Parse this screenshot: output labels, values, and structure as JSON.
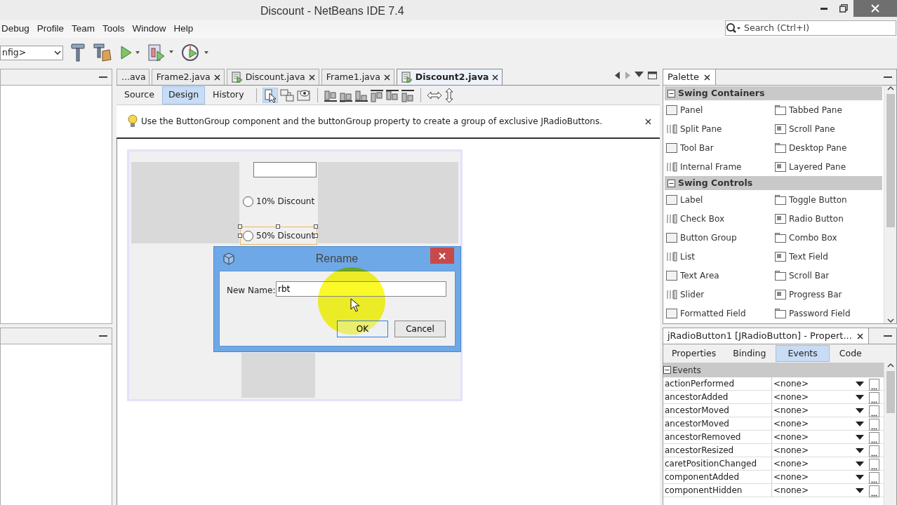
{
  "window": {
    "title": "Discount - NetBeans IDE 7.4"
  },
  "menu": [
    "Debug",
    "Profile",
    "Team",
    "Tools",
    "Window",
    "Help"
  ],
  "search": {
    "placeholder": "Search (Ctrl+I)"
  },
  "config_combo": {
    "value": "nfig>"
  },
  "editor_tabs": [
    {
      "label": "...ava",
      "selected": false,
      "closable": false,
      "kind": "plain"
    },
    {
      "label": "Frame2.java",
      "selected": false,
      "closable": true,
      "kind": "plain"
    },
    {
      "label": "Discount.java",
      "selected": false,
      "closable": true,
      "kind": "form"
    },
    {
      "label": "Frame1.java",
      "selected": false,
      "closable": true,
      "kind": "plain"
    },
    {
      "label": "Discount2.java",
      "selected": true,
      "closable": true,
      "kind": "form"
    }
  ],
  "view_tabs": [
    {
      "label": "Source",
      "selected": false
    },
    {
      "label": "Design",
      "selected": true
    },
    {
      "label": "History",
      "selected": false
    }
  ],
  "hint": {
    "text": "Use the ButtonGroup component and the buttonGroup property to create a group of exclusive JRadioButtons."
  },
  "form": {
    "radios": [
      {
        "label": "10% Discount",
        "checked": false,
        "selected": false
      },
      {
        "label": "50% Discount",
        "checked": false,
        "selected": true
      }
    ]
  },
  "dialog": {
    "title": "Rename",
    "label": "New Name:",
    "value": "rbt",
    "buttons": [
      {
        "label": "OK",
        "default": true
      },
      {
        "label": "Cancel",
        "default": false
      }
    ]
  },
  "palette": {
    "title": "Palette",
    "categories": [
      {
        "label": "Swing Containers",
        "expanded": true,
        "items": [
          "Panel",
          "Tabbed Pane",
          "Split Pane",
          "Scroll Pane",
          "Tool Bar",
          "Desktop Pane",
          "Internal Frame",
          "Layered Pane"
        ]
      },
      {
        "label": "Swing Controls",
        "expanded": true,
        "items": [
          "Label",
          "Toggle Button",
          "Check Box",
          "Radio Button",
          "Button Group",
          "Combo Box",
          "List",
          "Text Field",
          "Text Area",
          "Scroll Bar",
          "Slider",
          "Progress Bar",
          "Formatted Field",
          "Password Field"
        ]
      }
    ]
  },
  "properties": {
    "title": "jRadioButton1 [JRadioButton] - Propert...",
    "tabs": [
      {
        "label": "Properties",
        "selected": false
      },
      {
        "label": "Binding",
        "selected": false
      },
      {
        "label": "Events",
        "selected": true
      },
      {
        "label": "Code",
        "selected": false
      }
    ],
    "section": {
      "label": "Events",
      "expanded": true
    },
    "rows": [
      {
        "name": "actionPerformed",
        "value": "<none>"
      },
      {
        "name": "ancestorAdded",
        "value": "<none>"
      },
      {
        "name": "ancestorMoved",
        "value": "<none>"
      },
      {
        "name": "ancestorMoved",
        "value": "<none>"
      },
      {
        "name": "ancestorRemoved",
        "value": "<none>"
      },
      {
        "name": "ancestorResized",
        "value": "<none>"
      },
      {
        "name": "caretPositionChanged",
        "value": "<none>"
      },
      {
        "name": "componentAdded",
        "value": "<none>"
      },
      {
        "name": "componentHidden",
        "value": "<none>"
      }
    ]
  }
}
